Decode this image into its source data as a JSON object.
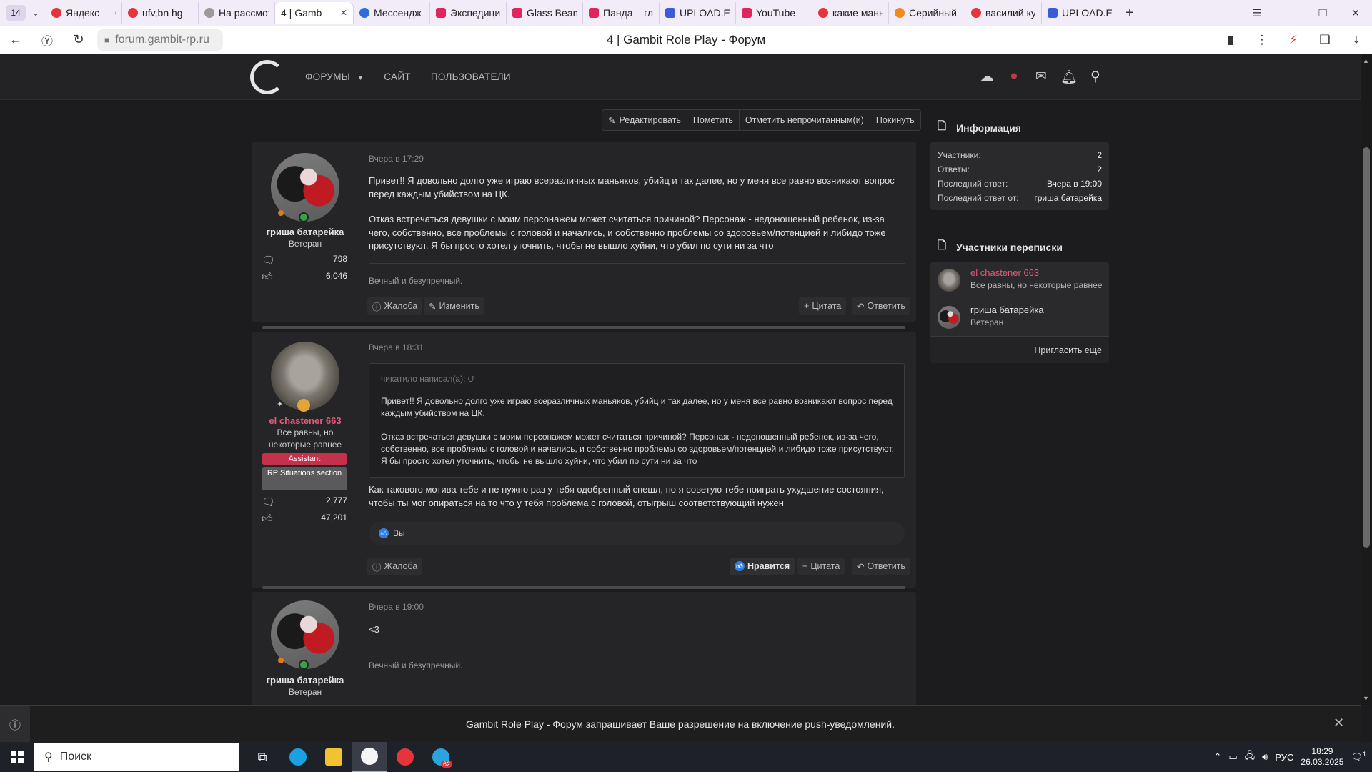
{
  "browser": {
    "tab_count": "14",
    "tabs": [
      {
        "title": "Яндекс — б",
        "color": "#e5343a"
      },
      {
        "title": "ufv,bn hg –",
        "color": "#e5343a"
      },
      {
        "title": "На рассмот",
        "color": "#9a9a9a"
      },
      {
        "title": "4 | Gamb",
        "color": "#ffffff",
        "active": true
      },
      {
        "title": "Мессендж",
        "color": "#2d6cdf"
      },
      {
        "title": "Экспедици",
        "color": "#e0245e"
      },
      {
        "title": "Glass Beam",
        "color": "#e0245e"
      },
      {
        "title": "Панда – гла",
        "color": "#e0245e"
      },
      {
        "title": "UPLOAD.EE",
        "color": "#3b5bdb"
      },
      {
        "title": "YouTube",
        "color": "#e0245e"
      },
      {
        "title": "какие мань",
        "color": "#e5343a"
      },
      {
        "title": "Серийный",
        "color": "#f08a1c"
      },
      {
        "title": "василий ку",
        "color": "#e5343a"
      },
      {
        "title": "UPLOAD.EE",
        "color": "#3b5bdb"
      }
    ],
    "url": "forum.gambit-rp.ru",
    "page_title": "4 | Gambit Role Play - Форум"
  },
  "header": {
    "nav": [
      {
        "label": "ФОРУМЫ"
      },
      {
        "label": "САЙТ"
      },
      {
        "label": "ПОЛЬЗОВАТЕЛИ"
      }
    ]
  },
  "thread_actions": {
    "edit": "Редактировать",
    "mark": "Пометить",
    "mark_unread": "Отметить непрочитанным(и)",
    "leave": "Покинуть"
  },
  "posts": [
    {
      "author": "гриша батарейка",
      "title": "Ветеран",
      "messages": "798",
      "likes": "6,046",
      "date": "Вчера в 17:29",
      "text1": "Привет!! Я довольно долго уже играю всеразличных маньяков, убийц и так далее, но у меня все равно возникают вопрос перед каждым убийством на ЦК.",
      "text2": "Отказ встречаться девушки с моим персонажем может считаться причиной? Персонаж - недоношенный ребенок, из-за чего, собственно, все проблемы с головой и начались, и собственно проблемы со здоровьем/потенцией и либидо тоже присутствуют. Я бы просто хотел уточнить, чтобы не вышло хуйни, что убил по сути ни за что",
      "signature": "Вечный и безупречный.",
      "btn_report": "Жалоба",
      "btn_edit": "Изменить",
      "btn_quote": "Цитата",
      "btn_reply": "Ответить"
    },
    {
      "author": "el chastener 663",
      "title": "Все равны, но некоторые равнее",
      "badge1": "Assistant",
      "badge2": "RP Situations section",
      "messages": "2,777",
      "likes": "47,201",
      "date": "Вчера в 18:31",
      "quote_head": "чикатило написал(а):",
      "quote1": "Привет!! Я довольно долго уже играю всеразличных маньяков, убийц и так далее, но у меня все равно возникают вопрос перед каждым убийством на ЦК.",
      "quote2": "Отказ встречаться девушки с моим персонажем может считаться причиной? Персонаж - недоношенный ребенок, из-за чего, собственно, все проблемы с головой и начались, и собственно проблемы со здоровьем/потенцией и либидо тоже присутствуют. Я бы просто хотел уточнить, чтобы не вышло хуйни, что убил по сути ни за что",
      "text": "Как такового мотива тебе и не нужно раз у тебя одобренный спешл, но я советую тебе поиграть ухудшение состояния, чтобы ты мог опираться на то что у тебя проблема с головой, отыгрыш соответствующий нужен",
      "reaction": "Вы",
      "btn_report": "Жалоба",
      "btn_like": "Нравится",
      "btn_quote": "Цитата",
      "btn_reply": "Ответить"
    },
    {
      "author": "гриша батарейка",
      "title": "Ветеран",
      "date": "Вчера в 19:00",
      "text": "<3",
      "signature": "Вечный и безупречный."
    }
  ],
  "sidebar": {
    "info_title": "Информация",
    "info": [
      {
        "k": "Участники:",
        "v": "2"
      },
      {
        "k": "Ответы:",
        "v": "2"
      },
      {
        "k": "Последний ответ:",
        "v": "Вчера в 19:00"
      },
      {
        "k": "Последний ответ от:",
        "v": "гриша батарейка"
      }
    ],
    "participants_title": "Участники переписки",
    "participants": [
      {
        "name": "el chastener 663",
        "title": "Все равны, но некоторые равнее"
      },
      {
        "name": "гриша батарейка",
        "title": "Ветеран"
      }
    ],
    "invite": "Пригласить ещё"
  },
  "notification": {
    "text": "Gambit Role Play - Форум запрашивает Ваше разрешение на включение push-уведомлений."
  },
  "taskbar": {
    "search": "Поиск",
    "telegram_count": "62",
    "lang": "РУС",
    "time": "18:29",
    "date": "26.03.2025",
    "notif_count": "1"
  }
}
